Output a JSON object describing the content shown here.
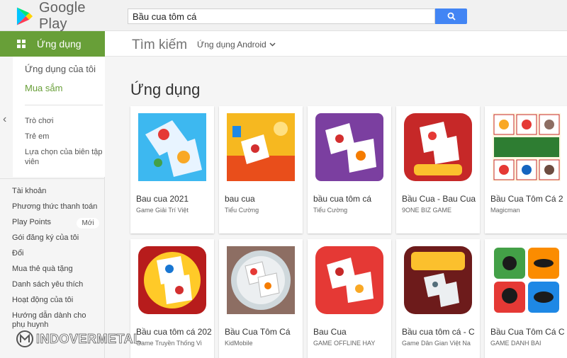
{
  "brand": {
    "name": "Google Play"
  },
  "search": {
    "value": "Bầu cua tôm cá"
  },
  "subheader": {
    "title": "Tìm kiếm",
    "filter": "Ứng dụng Android"
  },
  "sidebar": {
    "apps_label": "Ứng dụng",
    "my_apps": "Ứng dụng của tôi",
    "shop": "Mua sắm",
    "games": "Trò chơi",
    "kids": "Trẻ em",
    "editors": "Lựa chọn của biên tập viên",
    "account": [
      "Tài khoản",
      "Phương thức thanh toán",
      "Play Points",
      "Gói đăng ký của tôi",
      "Đổi",
      "Mua thẻ quà tặng",
      "Danh sách yêu thích",
      "Hoạt động của tôi",
      "Hướng dẫn dành cho phụ huynh"
    ],
    "new_badge": "Mới"
  },
  "main": {
    "section_title": "Ứng dụng",
    "apps": [
      {
        "title": "Bau cua 2021",
        "developer": "Game Giải Trí Việt"
      },
      {
        "title": "bau cua",
        "developer": "Tiểu Cường"
      },
      {
        "title": "bầu cua tôm cá",
        "developer": "Tiểu Cường"
      },
      {
        "title": "Bầu Cua - Bau Cua",
        "developer": "9ONE BIZ GAME"
      },
      {
        "title": "Bầu Cua Tôm Cá 2",
        "developer": "Magicman"
      },
      {
        "title": "Bầu cua tôm cá 202",
        "developer": "Game Truyền Thống Vi"
      },
      {
        "title": "Bầu Cua Tôm Cá",
        "developer": "KidMobile"
      },
      {
        "title": "Bau Cua",
        "developer": "GAME OFFLINE HAY"
      },
      {
        "title": "Bầu cua tôm cá - C",
        "developer": "Game Dân Gian Việt Na"
      },
      {
        "title": "Bầu Cua Tôm Cá C",
        "developer": "GAME DANH BAI"
      }
    ]
  },
  "watermark": {
    "text": "INDOVERMETAL"
  },
  "colors": {
    "accent": "#689f38",
    "search_button": "#4285f4"
  }
}
